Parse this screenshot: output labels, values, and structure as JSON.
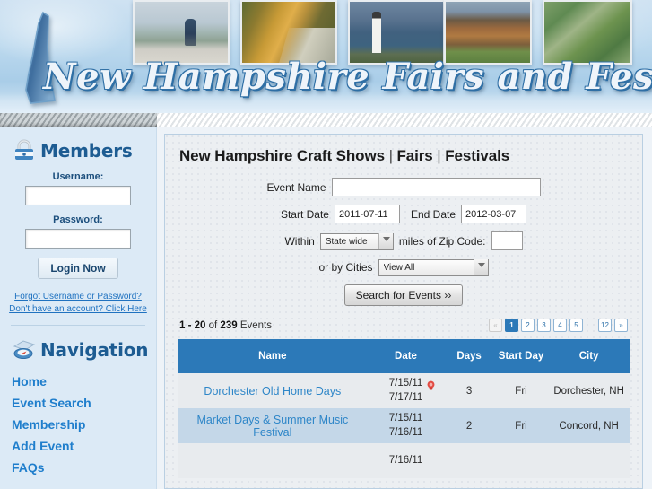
{
  "site": {
    "wordmark": "New Hampshire  Fairs and Festivals",
    "state_icon": "new-hampshire-state-outline"
  },
  "sidebar": {
    "members": {
      "heading": "Members",
      "icon": "padlock-icon",
      "username_label": "Username:",
      "username_value": "",
      "username_placeholder": "",
      "password_label": "Password:",
      "password_value": "",
      "password_placeholder": "",
      "login_button": "Login Now",
      "forgot_link": "Forgot Username or Password?",
      "register_link": "Don't have an account? Click Here"
    },
    "navigation": {
      "heading": "Navigation",
      "icon": "compass-icon",
      "items": [
        {
          "label": "Home"
        },
        {
          "label": "Event Search"
        },
        {
          "label": "Membership"
        },
        {
          "label": "Add Event"
        },
        {
          "label": "FAQs"
        }
      ]
    }
  },
  "main": {
    "title_part1": "New Hampshire Craft Shows",
    "title_sep1": " | ",
    "title_part2": "Fairs",
    "title_sep2": " | ",
    "title_part3": "Festivals",
    "form": {
      "event_name_label": "Event Name",
      "event_name_value": "",
      "start_date_label": "Start Date",
      "start_date_value": "2011-07-11",
      "end_date_label": "End Date",
      "end_date_value": "2012-03-07",
      "within_label": "Within",
      "within_value": "State wide",
      "within_options": [
        "State wide"
      ],
      "miles_label": "miles of Zip Code:",
      "zip_value": "",
      "cities_label": "or by Cities",
      "cities_value": "View All",
      "cities_options": [
        "View All"
      ],
      "search_button": "Search for Events ››"
    },
    "results": {
      "range": "1 - 20",
      "of_word": "of",
      "total": "239",
      "events_word": "Events",
      "pager": [
        {
          "label": "«",
          "state": "disabled",
          "name": "prev"
        },
        {
          "label": "1",
          "state": "active",
          "name": "page-1"
        },
        {
          "label": "2",
          "state": "normal",
          "name": "page-2"
        },
        {
          "label": "3",
          "state": "normal",
          "name": "page-3"
        },
        {
          "label": "4",
          "state": "normal",
          "name": "page-4"
        },
        {
          "label": "5",
          "state": "normal",
          "name": "page-5"
        },
        {
          "label": "…",
          "state": "ellipsis",
          "name": "page-gap"
        },
        {
          "label": "12",
          "state": "normal",
          "name": "page-12"
        },
        {
          "label": "»",
          "state": "normal",
          "name": "next"
        }
      ]
    },
    "table": {
      "columns": [
        "Name",
        "Date",
        "Days",
        "Start Day",
        "City"
      ],
      "rows": [
        {
          "name": "Dorchester Old Home Days",
          "date_start": "7/15/11",
          "date_end": "7/17/11",
          "flag": "red-marker-icon",
          "days": "3",
          "start_day": "Fri",
          "city": "Dorchester, NH"
        },
        {
          "name": "Market Days & Summer Music Festival",
          "date_start": "7/15/11",
          "date_end": "7/16/11",
          "flag": "",
          "days": "2",
          "start_day": "Fri",
          "city": "Concord, NH"
        },
        {
          "name": "",
          "date_start": "7/16/11",
          "date_end": "",
          "flag": "",
          "days": "",
          "start_day": "",
          "city": ""
        }
      ]
    }
  },
  "colors": {
    "header_blue": "#2c79b8",
    "link_blue": "#2e86c8",
    "nav_blue": "#1f7ecc",
    "sidebar_bg": "#dceaf6",
    "row_odd": "#e8ebee",
    "row_even": "#c4d7e8",
    "banner_blue": "#a9cde8"
  }
}
